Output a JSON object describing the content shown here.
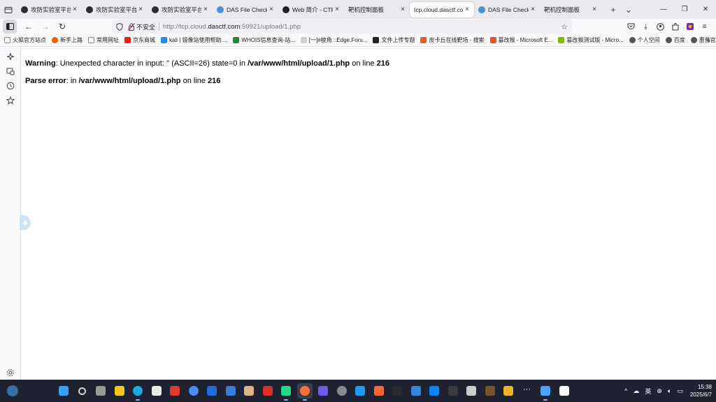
{
  "tabs": [
    {
      "title": "攻防实验室平台",
      "icon": "hacker-icon",
      "color": "#2b2b3a"
    },
    {
      "title": "攻防实验室平台",
      "icon": "hacker-icon",
      "color": "#2b2b3a"
    },
    {
      "title": "攻防实验室平台",
      "icon": "hacker-icon",
      "color": "#2b2b3a"
    },
    {
      "title": "DAS File Checker",
      "icon": "das-icon",
      "color": "#4a90d9"
    },
    {
      "title": "Web 简介 - CTF Wiki",
      "icon": "github-icon",
      "color": "#222222"
    },
    {
      "title": "靶机控制面板",
      "icon": "blank-icon",
      "color": "#ffffff"
    },
    {
      "title": "tcp.cloud.dasctf.com",
      "icon": "blank-icon",
      "color": "#ffffff"
    },
    {
      "title": "DAS File Checker",
      "icon": "das-icon",
      "color": "#4a90d9"
    },
    {
      "title": "靶机控制面板",
      "icon": "blank-icon",
      "color": "#ffffff"
    }
  ],
  "active_tab_index": 6,
  "url": {
    "insecure_label": "不安全",
    "prefix": "http://tcp.cloud.",
    "domain": "dasctf.com",
    "suffix": ":59921/upload/1.php"
  },
  "bookmarks": [
    {
      "label": "火狐官方站点",
      "icon": "folder-icon",
      "color": "#8a8a8a"
    },
    {
      "label": "新手上路",
      "icon": "firefox-icon",
      "color": "#e66000"
    },
    {
      "label": "常用网址",
      "icon": "folder-icon",
      "color": "#8a8a8a"
    },
    {
      "label": "京东商城",
      "icon": "jd-icon",
      "color": "#e1251b"
    },
    {
      "label": "kali | 镜像站使用帮助 ...",
      "icon": "kali-icon",
      "color": "#268bee"
    },
    {
      "label": "WHOIS信息查询-站...",
      "icon": "whois-icon",
      "color": "#1a8a3a"
    },
    {
      "label": "[一]#棱角 ::Edge.Foru...",
      "icon": "page-icon",
      "color": "#cfcfcf"
    },
    {
      "label": "文件上传专题",
      "icon": "video-icon",
      "color": "#222222"
    },
    {
      "label": "皮卡丘在线靶场 - 搜索",
      "icon": "pikachu-icon",
      "color": "#f05a28"
    },
    {
      "label": "篡改猴 - Microsoft E...",
      "icon": "ms-icon",
      "color": "#f25022"
    },
    {
      "label": "篡改猴测试版 - Micro...",
      "icon": "ms-icon",
      "color": "#7fba00"
    },
    {
      "label": "个人空间",
      "icon": "globe-icon",
      "color": "#555555"
    },
    {
      "label": "百度",
      "icon": "globe-icon",
      "color": "#555555"
    },
    {
      "label": "惠普官网",
      "icon": "globe-icon",
      "color": "#555555"
    }
  ],
  "content": {
    "line1": {
      "label": "Warning",
      "text": ": Unexpected character in input: '' (ASCII=26) state=0 in ",
      "path": "/var/www/html/upload/1.php",
      "on_line": " on line ",
      "line_no": "216"
    },
    "line2": {
      "label": "Parse error",
      "text": ": in ",
      "path": "/var/www/html/upload/1.php",
      "on_line": " on line ",
      "line_no": "216"
    }
  },
  "taskbar_apps": [
    {
      "name": "start",
      "color": "#3aa0ff"
    },
    {
      "name": "search",
      "color": "#d0d0d0"
    },
    {
      "name": "task-view",
      "color": "#9a9a9a"
    },
    {
      "name": "file-explorer",
      "color": "#f5c518"
    },
    {
      "name": "edge",
      "color": "#1fa9e1"
    },
    {
      "name": "store",
      "color": "#e8e8e8"
    },
    {
      "name": "app-red",
      "color": "#e03a2f"
    },
    {
      "name": "chrome",
      "color": "#4a8df0"
    },
    {
      "name": "files",
      "color": "#1e6fd9"
    },
    {
      "name": "photos",
      "color": "#3b7bd8"
    },
    {
      "name": "app-beige",
      "color": "#d8b48a"
    },
    {
      "name": "wps",
      "color": "#d9302c"
    },
    {
      "name": "pycharm",
      "color": "#21d789"
    },
    {
      "name": "firefox",
      "color": "#ff7139"
    },
    {
      "name": "app-purple",
      "color": "#6c5ce7"
    },
    {
      "name": "app-gray",
      "color": "#8a8a8a"
    },
    {
      "name": "app-blue",
      "color": "#1d9bf0"
    },
    {
      "name": "burp",
      "color": "#ff6633"
    },
    {
      "name": "terminal",
      "color": "#2b2b2b"
    },
    {
      "name": "app-teal",
      "color": "#2e86de"
    },
    {
      "name": "app-cyan",
      "color": "#0a84ff"
    },
    {
      "name": "app-dark",
      "color": "#3a3a3a"
    },
    {
      "name": "app-light",
      "color": "#cccccc"
    },
    {
      "name": "app-brown",
      "color": "#7a5230"
    },
    {
      "name": "app-gold",
      "color": "#f0b429"
    },
    {
      "name": "more",
      "color": "#1f2231"
    },
    {
      "name": "notes",
      "color": "#4aa3ff"
    },
    {
      "name": "typora",
      "color": "#ffffff"
    }
  ],
  "tray": {
    "ime": "英",
    "time": "15:38",
    "date": "2025/6/7"
  }
}
